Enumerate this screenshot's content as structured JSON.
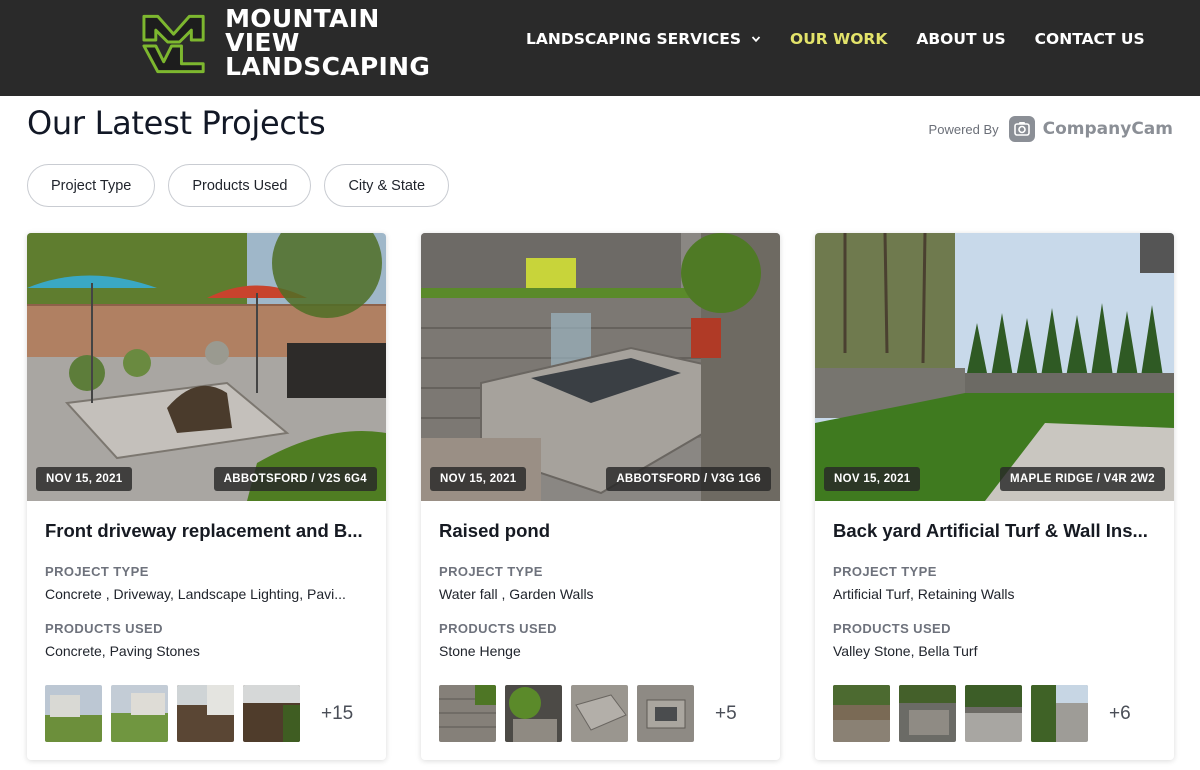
{
  "brand": {
    "name_line1": "MOUNTAIN VIEW",
    "name_line2": "LANDSCAPING",
    "colors": {
      "header_bg": "#2a2a2a",
      "accent": "#e3e36a",
      "logo_green": "#7db72f"
    }
  },
  "nav": {
    "items": [
      {
        "label": "LANDSCAPING SERVICES",
        "has_dropdown": true,
        "icon": "chevron-down-icon"
      },
      {
        "label": "OUR WORK",
        "active": true
      },
      {
        "label": "ABOUT US"
      },
      {
        "label": "CONTACT US"
      }
    ]
  },
  "page": {
    "title": "Our Latest Projects",
    "powered_by_label": "Powered By",
    "powered_by_brand": "CompanyCam"
  },
  "filters": [
    {
      "label": "Project Type"
    },
    {
      "label": "Products Used"
    },
    {
      "label": "City & State"
    }
  ],
  "cards": [
    {
      "date": "NOV 15, 2021",
      "location": "ABBOTSFORD / V2S 6G4",
      "title": "Front driveway replacement and B...",
      "project_type_label": "PROJECT TYPE",
      "project_type": "Concrete , Driveway, Landscape Lighting, Pavi...",
      "products_label": "PRODUCTS USED",
      "products": "Concrete, Paving Stones",
      "more": "+15"
    },
    {
      "date": "NOV 15, 2021",
      "location": "ABBOTSFORD / V3G 1G6",
      "title": "Raised pond",
      "project_type_label": "PROJECT TYPE",
      "project_type": "Water fall , Garden Walls",
      "products_label": "PRODUCTS USED",
      "products": "Stone Henge",
      "more": "+5"
    },
    {
      "date": "NOV 15, 2021",
      "location": "MAPLE RIDGE / V4R 2W2",
      "title": "Back yard Artificial Turf & Wall Ins...",
      "project_type_label": "PROJECT TYPE",
      "project_type": "Artificial Turf, Retaining Walls",
      "products_label": "PRODUCTS USED",
      "products": "Valley Stone, Bella Turf",
      "more": "+6"
    }
  ]
}
